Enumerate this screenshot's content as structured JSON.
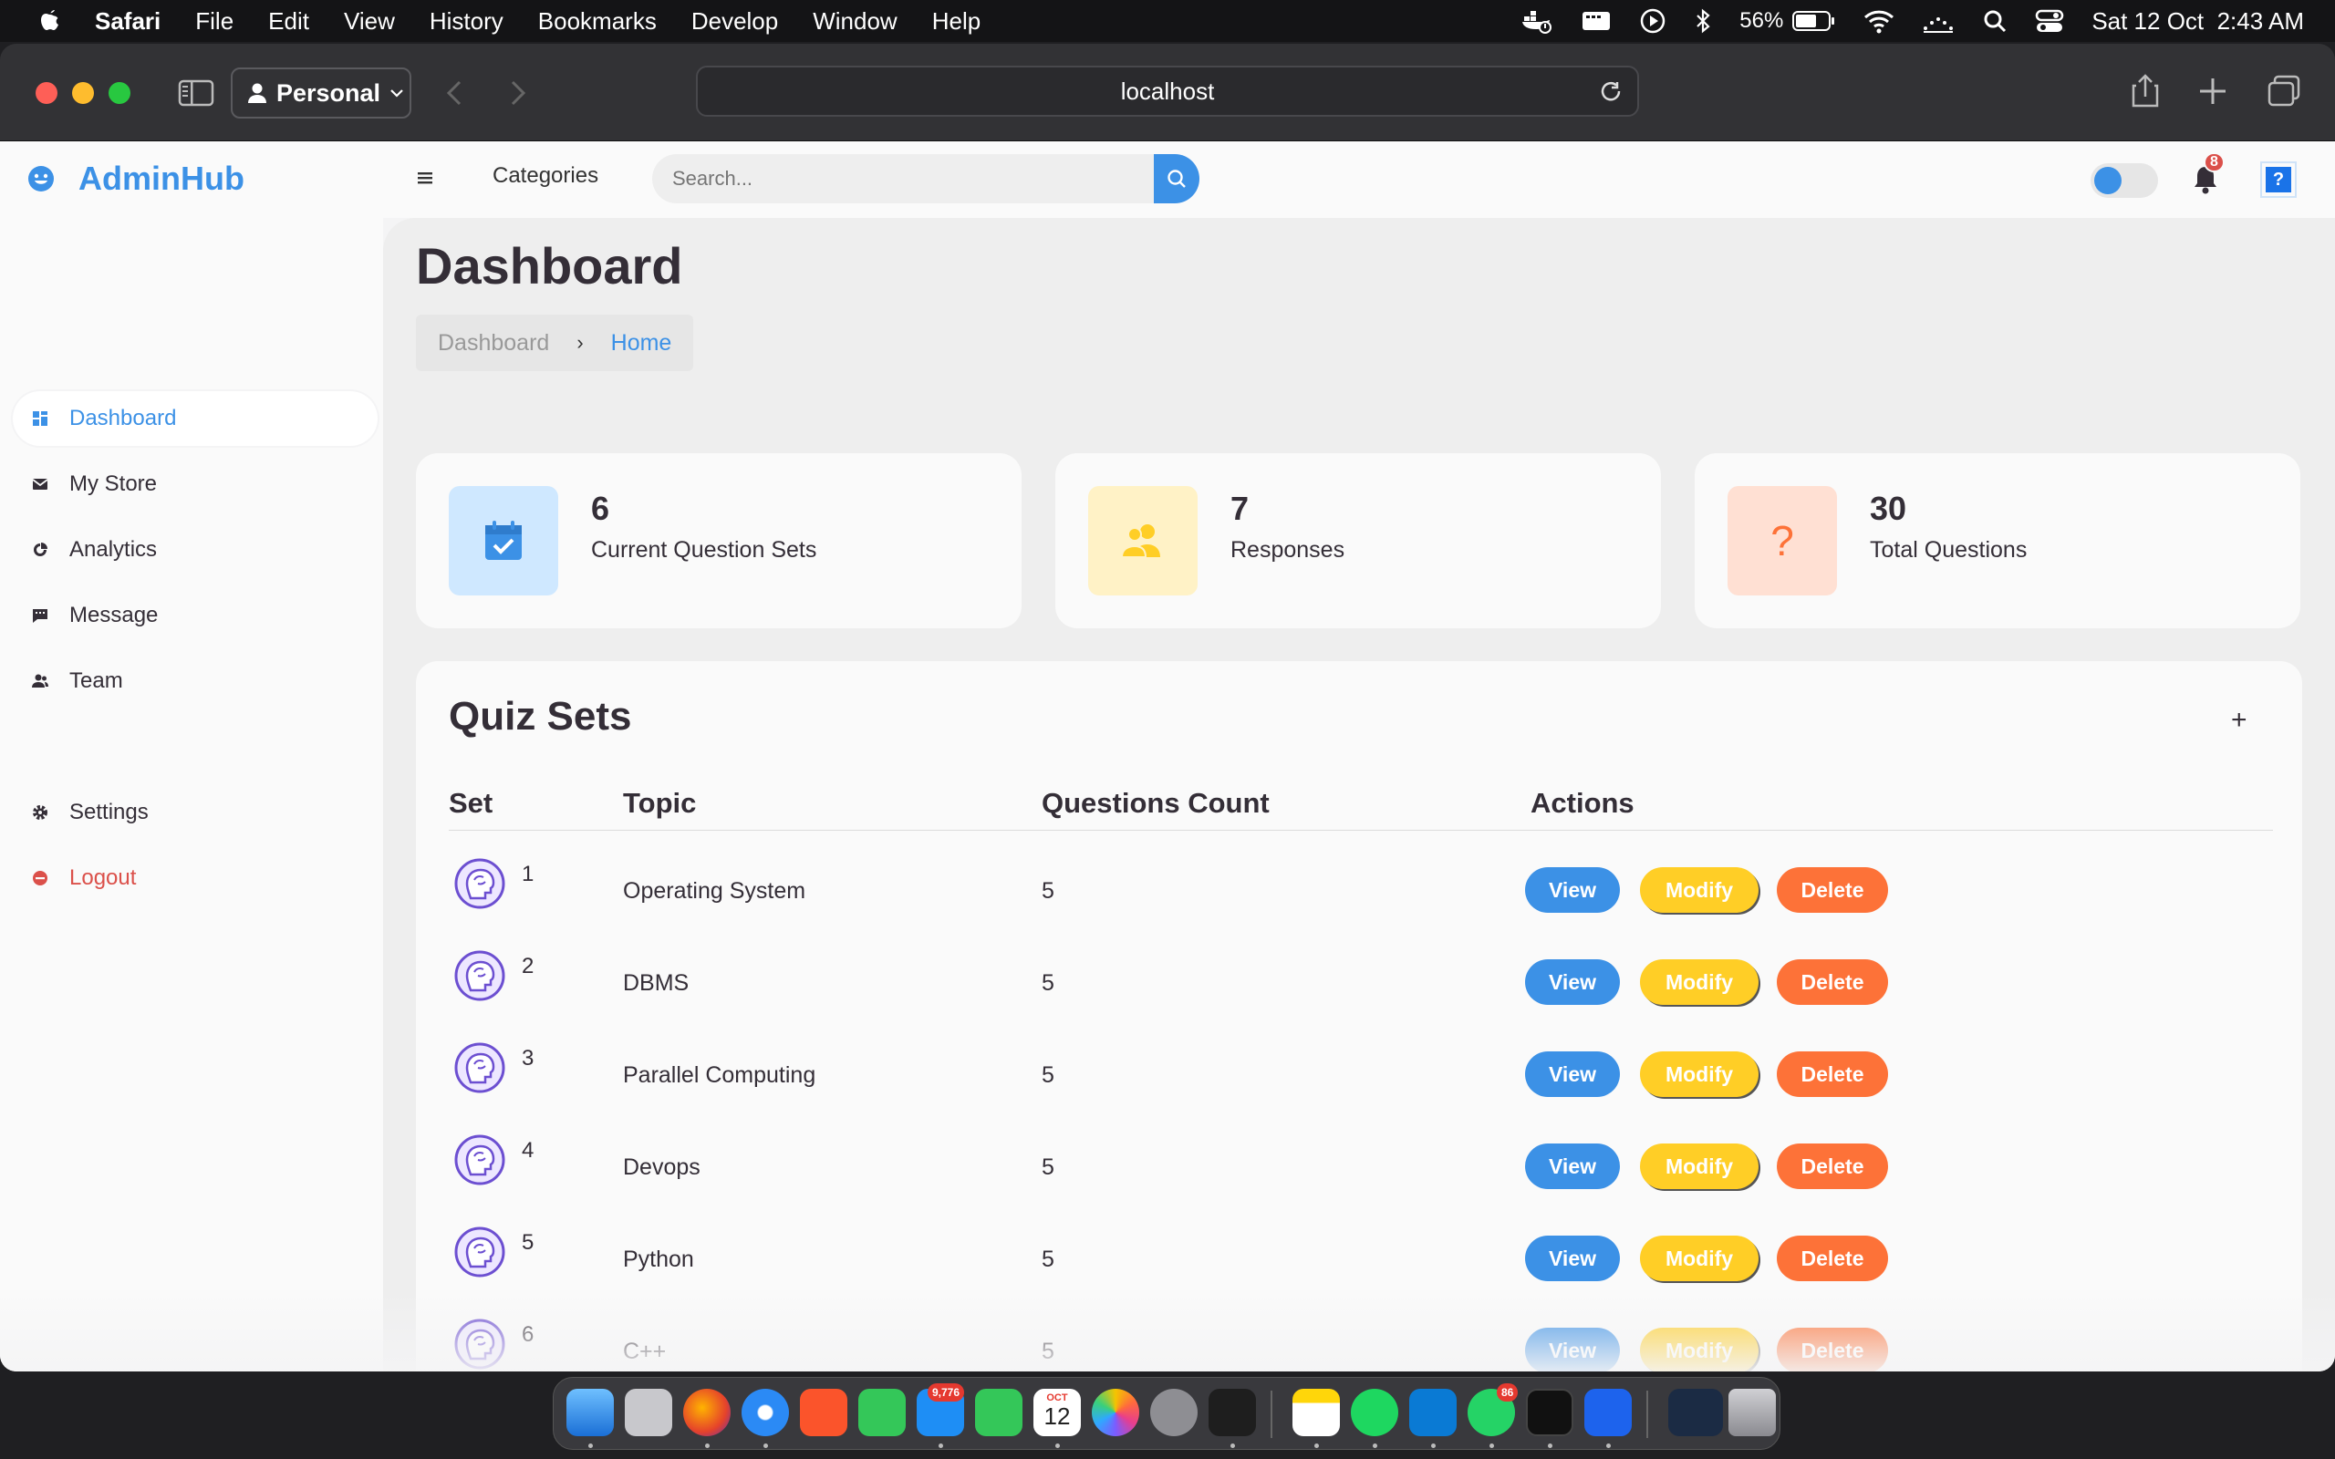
{
  "menubar": {
    "app": "Safari",
    "items": [
      "File",
      "Edit",
      "View",
      "History",
      "Bookmarks",
      "Develop",
      "Window",
      "Help"
    ],
    "battery": "56%",
    "datetime": "Sat 12 Oct  2:43 AM"
  },
  "browser": {
    "profile": "Personal",
    "url": "localhost"
  },
  "header": {
    "brand": "AdminHub",
    "categories": "Categories",
    "search_placeholder": "Search...",
    "notification_count": "8",
    "help": "?"
  },
  "sidebar": {
    "items": [
      {
        "label": "Dashboard",
        "icon": "dashboard-icon"
      },
      {
        "label": "My Store",
        "icon": "store-icon"
      },
      {
        "label": "Analytics",
        "icon": "analytics-icon"
      },
      {
        "label": "Message",
        "icon": "message-icon"
      },
      {
        "label": "Team",
        "icon": "team-icon"
      }
    ],
    "settings": "Settings",
    "logout": "Logout"
  },
  "main": {
    "title": "Dashboard",
    "breadcrumb": [
      "Dashboard",
      "Home"
    ],
    "stats": [
      {
        "value": "6",
        "label": "Current Question Sets",
        "icon": "calendar-check-icon"
      },
      {
        "value": "7",
        "label": "Responses",
        "icon": "users-icon"
      },
      {
        "value": "30",
        "label": "Total Questions",
        "icon": "question-icon"
      }
    ],
    "quiz": {
      "title": "Quiz Sets",
      "add": "+",
      "columns": [
        "Set",
        "Topic",
        "Questions Count",
        "Actions"
      ],
      "rows": [
        {
          "set": "1",
          "topic": "Operating System",
          "count": "5"
        },
        {
          "set": "2",
          "topic": "DBMS",
          "count": "5"
        },
        {
          "set": "3",
          "topic": "Parallel Computing",
          "count": "5"
        },
        {
          "set": "4",
          "topic": "Devops",
          "count": "5"
        },
        {
          "set": "5",
          "topic": "Python",
          "count": "5"
        },
        {
          "set": "6",
          "topic": "C++",
          "count": "5"
        }
      ],
      "actions": {
        "view": "View",
        "modify": "Modify",
        "delete": "Delete"
      }
    }
  },
  "dock": {
    "mail_badge": "9,776",
    "calendar_month": "OCT",
    "calendar_day": "12",
    "whatsapp_badge": "86"
  },
  "colors": {
    "accent": "#3c91e6",
    "yellow": "#ffce26",
    "orange": "#fd7238",
    "red": "#db504a"
  }
}
